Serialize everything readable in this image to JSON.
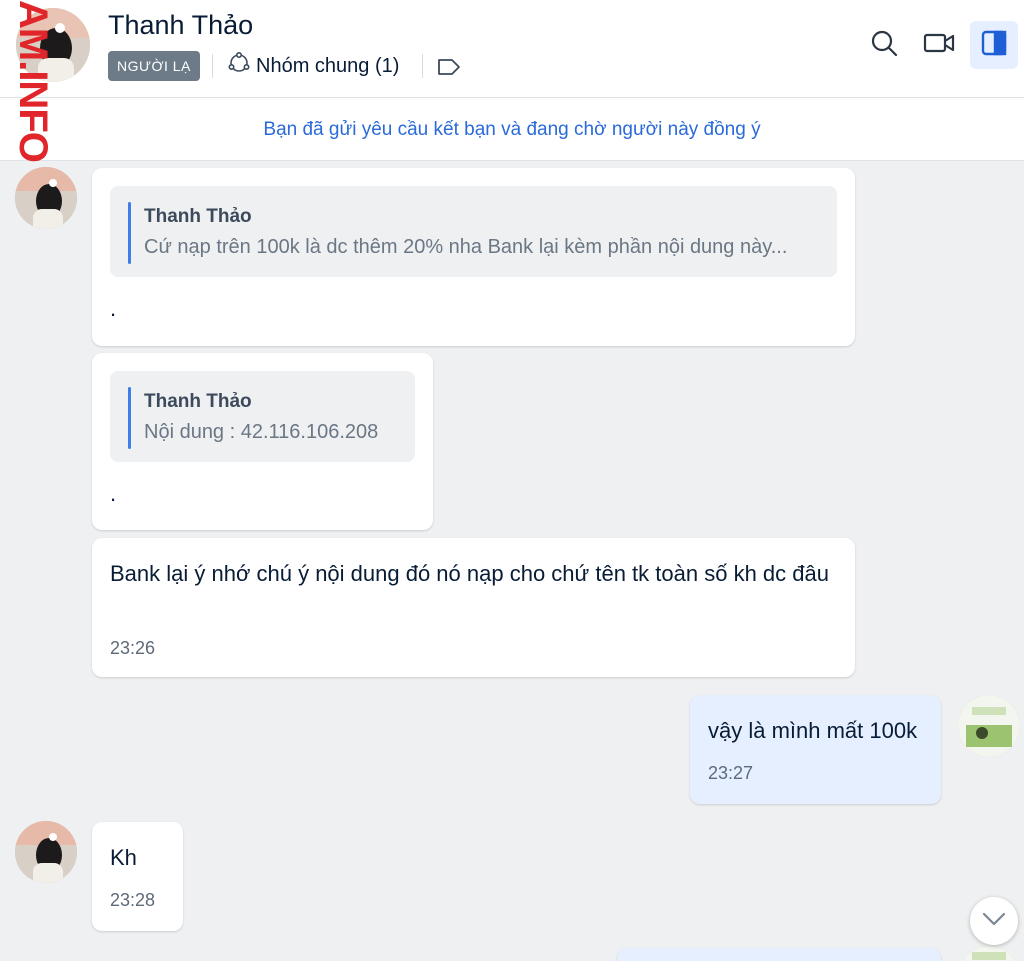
{
  "header": {
    "contact_name": "Thanh Thảo",
    "stranger_badge": "NGƯỜI LẠ",
    "common_groups": "Nhóm chung (1)",
    "icons": [
      "people-circle-icon",
      "tag-icon",
      "search-icon",
      "video-call-icon",
      "sidebar-toggle-icon"
    ]
  },
  "watermark": "AM.INFO",
  "friend_request_notice": "Bạn đã gửi yêu cầu kết bạn và đang chờ người này đồng ý",
  "messages": [
    {
      "sender": "Thanh Thảo",
      "quote_name": "Thanh Thảo",
      "quote_text": "Cứ nạp trên 100k là dc thêm 20% nha Bank lại kèm phần nội dung này...",
      "text": "."
    },
    {
      "sender": "Thanh Thảo",
      "quote_name": "Thanh Thảo",
      "quote_text": "Nội dung : 42.116.106.208",
      "text": "."
    },
    {
      "sender": "Thanh Thảo",
      "text": "Bank lại ý nhớ chú ý nội dung đó nó nạp cho chứ tên tk toàn số kh dc đâu",
      "time": "23:26"
    },
    {
      "sender": "me",
      "text": "vậy là mình mất 100k",
      "time": "23:27"
    },
    {
      "sender": "Thanh Thảo",
      "text": "Kh",
      "time": "23:28"
    }
  ],
  "colors": {
    "accent": "#2a6ad9",
    "quote_bar": "#3f7ee8",
    "my_bubble": "#e5efff",
    "background": "#eef0f1",
    "watermark": "#e0262b"
  }
}
